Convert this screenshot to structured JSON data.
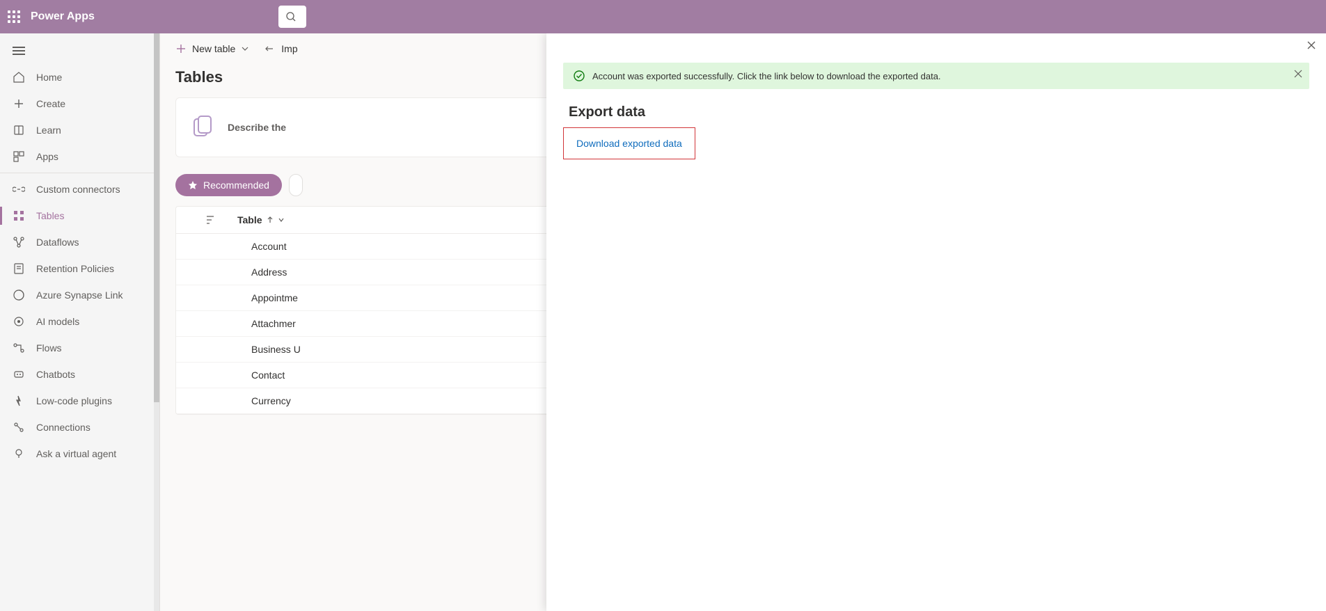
{
  "header": {
    "app_title": "Power Apps"
  },
  "sidebar": {
    "items": [
      {
        "label": "Home",
        "icon": "home"
      },
      {
        "label": "Create",
        "icon": "plus"
      },
      {
        "label": "Learn",
        "icon": "book"
      },
      {
        "label": "Apps",
        "icon": "apps"
      }
    ],
    "items2": [
      {
        "label": "Custom connectors",
        "icon": "connector"
      },
      {
        "label": "Tables",
        "icon": "grid",
        "active": true
      },
      {
        "label": "Dataflows",
        "icon": "dataflow"
      },
      {
        "label": "Retention Policies",
        "icon": "policy"
      },
      {
        "label": "Azure Synapse Link",
        "icon": "synapse"
      },
      {
        "label": "AI models",
        "icon": "ai"
      },
      {
        "label": "Flows",
        "icon": "flow"
      },
      {
        "label": "Chatbots",
        "icon": "chatbot"
      },
      {
        "label": "Low-code plugins",
        "icon": "plugin"
      },
      {
        "label": "Connections",
        "icon": "connections"
      },
      {
        "label": "Ask a virtual agent",
        "icon": "agent"
      }
    ]
  },
  "toolbar": {
    "new_table": "New table",
    "import": "Imp"
  },
  "page": {
    "heading": "Tables",
    "describe": "Describe the"
  },
  "pills": {
    "recommended": "Recommended"
  },
  "table": {
    "header_label": "Table",
    "rows": [
      "Account",
      "Address",
      "Appointme",
      "Attachmer",
      "Business U",
      "Contact",
      "Currency"
    ]
  },
  "panel": {
    "notice": "Account was exported successfully. Click the link below to download the exported data.",
    "title": "Export data",
    "download": "Download exported data"
  }
}
